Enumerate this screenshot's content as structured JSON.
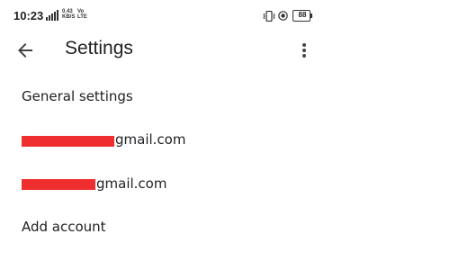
{
  "status_bar": {
    "time": "10:23",
    "network_speed": "0.43\nKB/S",
    "volte": "Vo\nLTE",
    "battery_level": "88"
  },
  "app_bar": {
    "title": "Settings",
    "back_icon": "arrow-back-icon",
    "more_icon": "more-vert-icon"
  },
  "settings": {
    "items": [
      {
        "label": "General settings"
      },
      {
        "label": "gmail.com",
        "redacted": true
      },
      {
        "label": "gmail.com",
        "redacted": true
      },
      {
        "label": "Add account"
      }
    ]
  },
  "colors": {
    "background": "#ffffff",
    "text": "#202124",
    "redaction": "#ef2f2f"
  }
}
